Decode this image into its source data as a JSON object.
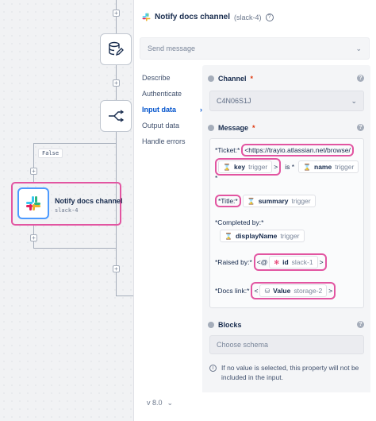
{
  "canvas": {
    "false_label": "False",
    "slack_node": {
      "title": "Notify docs channel",
      "subtitle": "slack-4"
    }
  },
  "panel": {
    "title": "Notify docs channel",
    "subtitle": "(slack-4)",
    "send_select": {
      "value": "Send message"
    },
    "nav": [
      {
        "label": "Describe",
        "active": false
      },
      {
        "label": "Authenticate",
        "active": false
      },
      {
        "label": "Input data",
        "active": true
      },
      {
        "label": "Output data",
        "active": false
      },
      {
        "label": "Handle errors",
        "active": false
      }
    ],
    "nav_arrow": "›",
    "version": "v 8.0"
  },
  "channel": {
    "label": "Channel",
    "required": "*",
    "value": "C4N06S1J"
  },
  "message": {
    "label": "Message",
    "required": "*",
    "ticket_prefix": "*Ticket:*",
    "ticket_url": "<https://trayio.atlassian.net/browse/",
    "key_pill": {
      "name": "key",
      "source": "trigger"
    },
    "pipe_is": "|",
    "is_text": "is *",
    "name_pill": {
      "name": "name",
      "source": "trigger"
    },
    "star": "*",
    "title_label": "*Title:*",
    "summary_pill": {
      "name": "summary",
      "source": "trigger"
    },
    "completed_label": "*Completed by:*",
    "displayname_pill": {
      "name": "displayName",
      "source": "trigger"
    },
    "raised_label": "*Raised by:*",
    "raised_prefix": "<@",
    "id_pill": {
      "name": "id",
      "source": "slack-1"
    },
    "gt": ">",
    "docs_label": "*Docs link:*",
    "lt": "<",
    "value_pill": {
      "name": "Value",
      "source": "storage-2"
    }
  },
  "blocks": {
    "label": "Blocks",
    "placeholder": "Choose schema",
    "info": "If no value is selected, this property will not be included in the input."
  },
  "colors": {
    "highlight": "#e255a1",
    "accent": "#0052cc",
    "node_border": "#4c9aff"
  }
}
